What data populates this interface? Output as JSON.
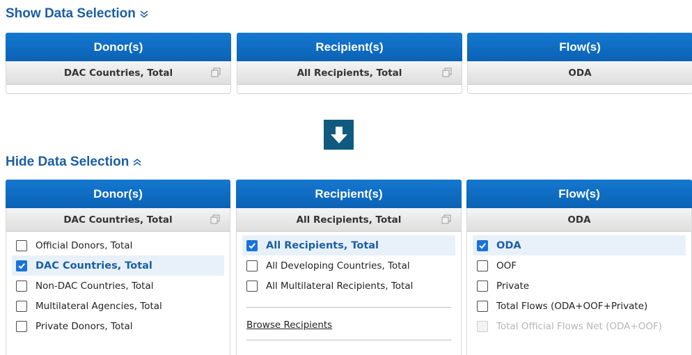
{
  "top": {
    "toggle_label": "Show Data Selection",
    "panels": [
      {
        "title": "Donor(s)",
        "value": "DAC Countries, Total"
      },
      {
        "title": "Recipient(s)",
        "value": "All Recipients, Total"
      },
      {
        "title": "Flow(s)",
        "value": "ODA"
      }
    ]
  },
  "bottom": {
    "toggle_label": "Hide Data Selection",
    "donor": {
      "title": "Donor(s)",
      "value": "DAC Countries, Total",
      "items": [
        {
          "label": "Official Donors, Total",
          "checked": false
        },
        {
          "label": "DAC Countries, Total",
          "checked": true
        },
        {
          "label": "Non-DAC Countries, Total",
          "checked": false
        },
        {
          "label": "Multilateral Agencies, Total",
          "checked": false
        },
        {
          "label": "Private Donors, Total",
          "checked": false
        }
      ]
    },
    "recipient": {
      "title": "Recipient(s)",
      "value": "All Recipients, Total",
      "items": [
        {
          "label": "All Recipients, Total",
          "checked": true
        },
        {
          "label": "All Developing Countries, Total",
          "checked": false
        },
        {
          "label": "All Multilateral Recipients, Total",
          "checked": false
        }
      ],
      "browse_label": "Browse Recipients"
    },
    "flow": {
      "title": "Flow(s)",
      "value": "ODA",
      "items": [
        {
          "label": "ODA",
          "checked": true
        },
        {
          "label": "OOF",
          "checked": false
        },
        {
          "label": "Private",
          "checked": false
        },
        {
          "label": "Total Flows (ODA+OOF+Private)",
          "checked": false
        },
        {
          "label": "Total Official Flows Net (ODA+OOF)",
          "checked": false,
          "disabled": true
        }
      ]
    }
  },
  "colors": {
    "header_blue": "#0b6fc6",
    "link_blue": "#1b5ea6",
    "arrow_box": "#0f5a7e",
    "checkbox_blue": "#1a73d9"
  },
  "icons": {
    "show_chevron": "double-chevron-down-icon",
    "hide_chevron": "double-chevron-up-icon",
    "arrow": "arrow-down-icon",
    "copy": "copy-icon"
  }
}
